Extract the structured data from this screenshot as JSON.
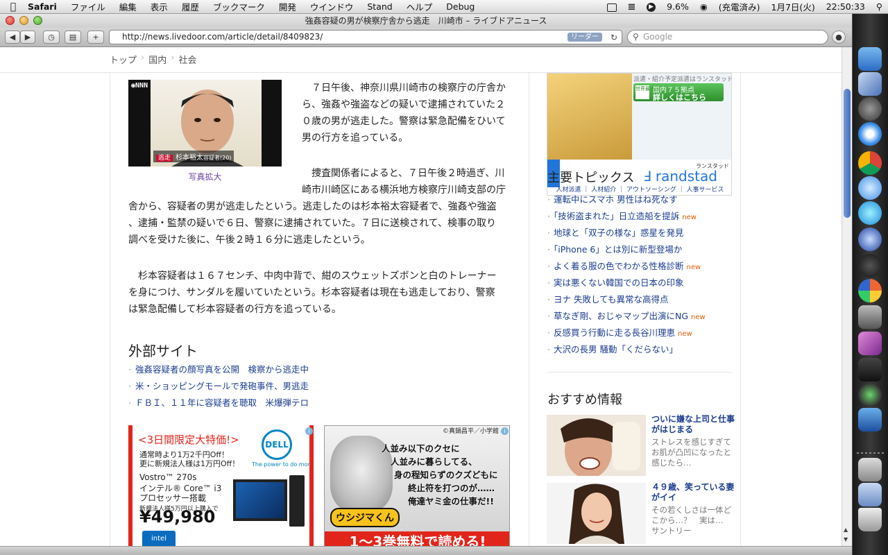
{
  "menubar": {
    "app_name": "Safari",
    "menus": [
      "ファイル",
      "編集",
      "表示",
      "履歴",
      "ブックマーク",
      "開発",
      "ウインドウ",
      "Stand",
      "ヘルプ",
      "Debug"
    ],
    "battery_percent": "9.6%",
    "charging_status": "(充電済み)",
    "date": "1月7日(火)",
    "time": "22:50:33"
  },
  "window": {
    "title": "強姦容疑の男が検察庁舎から逃走　川崎市 – ライブドアニュース",
    "url": "http://news.livedoor.com/article/detail/8409823/",
    "reader_label": "リーダー",
    "search_placeholder": "Google"
  },
  "breadcrumb": [
    "トップ",
    "国内",
    "社会"
  ],
  "article": {
    "photo_caption_tag": "逃走",
    "photo_caption_name": "杉本裕太",
    "photo_caption_suffix": "容疑者(20)",
    "photo_network": "NNN",
    "photo_enlarge": "写真拡大",
    "paragraphs": [
      [
        "　７日午後、神奈川県川崎市の検察庁の庁舎か",
        "ら、強姦や強盗などの疑いで逮捕されていた２",
        "０歳の男が逃走した。警察は緊急配備をひいて",
        "男の行方を追っている。"
      ],
      [
        "　捜査関係者によると、７日午後２時過ぎ、川",
        "崎市川崎区にある横浜地方検察庁川崎支部の庁",
        "舎から、容疑者の男が逃走したという。逃走したのは杉本裕太容疑者で、強姦や強盗",
        "、逮捕・監禁の疑いで６日、警察に逮捕されていた。７日に送検されて、検事の取り",
        "調べを受けた後に、午後２時１６分に逃走したという。"
      ],
      [
        "　杉本容疑者は１６７センチ、中肉中背で、紺のスウェットズボンと白のトレーナー",
        "を身につけ、サンダルを履いていたという。杉本容疑者は現在も逃走しており、警察",
        "は緊急配備して杉本容疑者の行方を追っている。"
      ]
    ]
  },
  "external": {
    "title": "外部サイト",
    "links": [
      "強姦容疑者の顔写真を公開　検察から逃走中",
      "米・ショッピングモールで発砲事件、男逃走",
      "ＦＢＩ、１１年に容疑者を聴取　米爆弾テロ"
    ]
  },
  "ad_dell": {
    "banner": "<3日間限定大特価!>",
    "line1": "通常時より1万2千円Off！",
    "line2": "更に新規法人様は1万円Off！",
    "model": "Vostro™ 270s",
    "cpu1": "インテル® Core™ i3",
    "cpu2": "プロセッサー搭載",
    "condition": "新規法人様5万円以上購入で",
    "price": "¥49,980",
    "logo": "DELL",
    "tagline": "The power to do more",
    "intel": "intel inside"
  },
  "ad_manga": {
    "copyright": "©真鍋昌平／小学館",
    "lines": [
      "人並み以下のクセに",
      "人並みに暮らしてる、",
      "身の程知らずのクズどもに",
      "終止符を打つのが……",
      "俺達ヤミ金の仕事だ!!"
    ],
    "logo": "ウシジマくん",
    "free": "1〜3巻無料で読める!"
  },
  "ad_randstad": {
    "snippet": "派遣・紹介予定派遣はランスタッド",
    "cta_badge": "世界最大級",
    "cta_line1": "国内７５拠点",
    "cta_line2": "詳しくはこちら",
    "kana": "ランスタッド",
    "logo": "randstad",
    "links": "人材派遣 ｜ 人材紹介 ｜ アウトソーシング ｜ 人事サービス"
  },
  "topics": {
    "title": "主要トピックス",
    "items": [
      {
        "text": "運転中にスマホ 男性はね死なす",
        "new": ""
      },
      {
        "text": "「技術盗まれた」日立造船を提訴",
        "new": "new"
      },
      {
        "text": "地球と「双子の様な」惑星を発見",
        "new": ""
      },
      {
        "text": "「iPhone 6」とは別に新型登場か",
        "new": ""
      },
      {
        "text": "よく着る服の色でわかる性格診断",
        "new": "new"
      },
      {
        "text": "実は悪くない韓国での日本の印象",
        "new": ""
      },
      {
        "text": "ヨナ 失敗しても異常な高得点",
        "new": ""
      },
      {
        "text": "草なぎ剛、おじゃマップ出演にNG",
        "new": "new"
      },
      {
        "text": "反感買う行動に走る長谷川理恵",
        "new": "new"
      },
      {
        "text": "大沢の長男 騒動「くだらない」",
        "new": ""
      }
    ]
  },
  "recommend": {
    "title": "おすすめ情報",
    "items": [
      {
        "title1": "ついに嫌な上司と仕事",
        "title2": "がはじまる",
        "desc1": "ストレスを感じすぎて",
        "desc2": "お肌が凸凹になったと",
        "desc3": "感じたら…"
      },
      {
        "title1": "４９歳、笑っている妻",
        "title2": "がイイ",
        "desc1": "その若くしさは一体ど",
        "desc2": "こから…？　実は…",
        "desc3": "サントリー"
      }
    ]
  },
  "dock_icons": [
    "finder",
    "preview-stamp",
    "itunes-speaker",
    "safari",
    "chrome",
    "itunes",
    "quicktime",
    "dvd-player",
    "system-clock",
    "colorsync",
    "system-preferences",
    "aperture-pro",
    "coda",
    "time-machine",
    "boot-camp",
    "downloads-stack",
    "documents-stack",
    "trash"
  ]
}
